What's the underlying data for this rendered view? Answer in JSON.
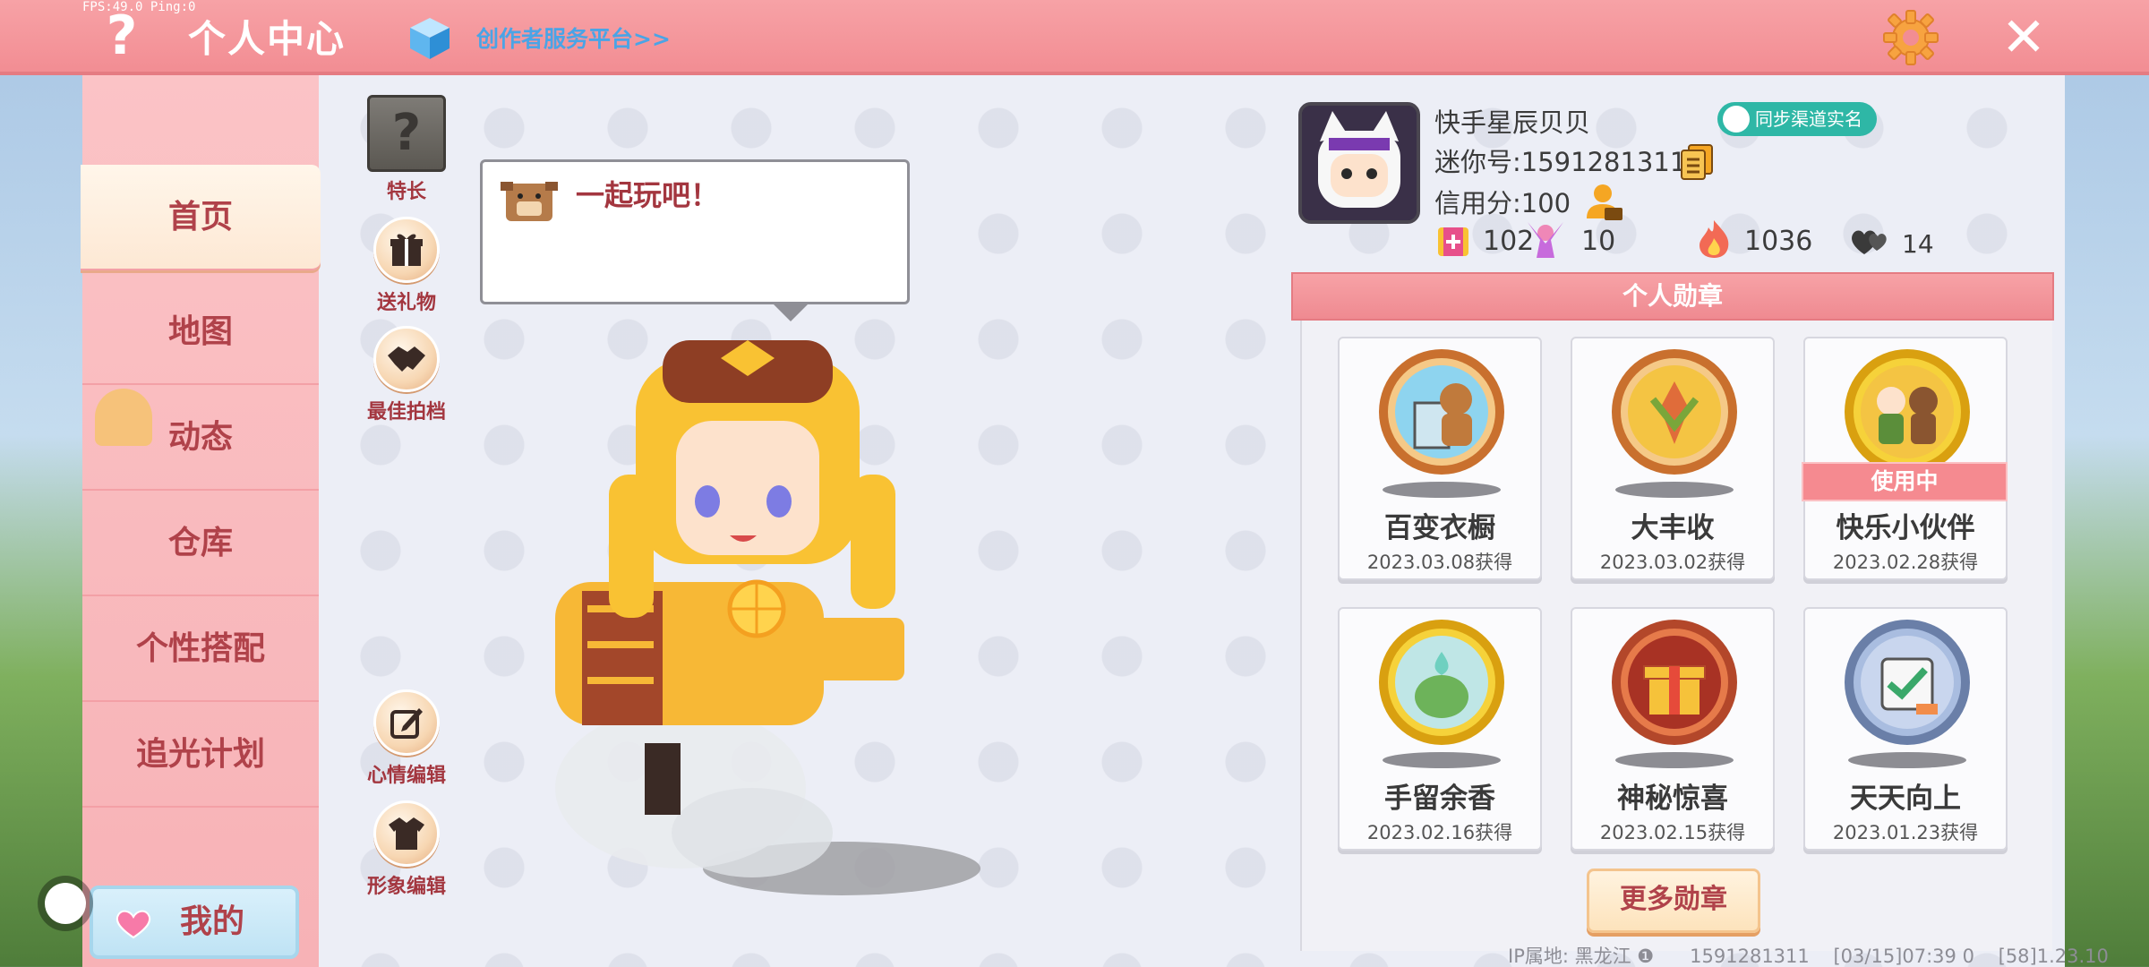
{
  "debug": "FPS:49.0  Ping:0",
  "topbar": {
    "title": "个人中心",
    "creator_link": "创作者服务平台>>",
    "help_glyph": "?",
    "close_glyph": "✕"
  },
  "sidebar": {
    "items": [
      {
        "label": "首页"
      },
      {
        "label": "地图"
      },
      {
        "label": "动态"
      },
      {
        "label": "仓库"
      },
      {
        "label": "个性搭配"
      },
      {
        "label": "追光计划"
      }
    ],
    "mine": "我的"
  },
  "actions": {
    "specialty": "特长",
    "gift": "送礼物",
    "partner": "最佳拍档",
    "mood": "心情编辑",
    "look": "形象编辑"
  },
  "bubble": {
    "text": "一起玩吧！"
  },
  "profile": {
    "name": "快手星辰贝贝",
    "mini_id": "迷你号:1591281311",
    "credit": "信用分:100",
    "sync_badge": "同步渠道实名",
    "stats": {
      "gifts": "102",
      "likes": "10",
      "popularity": "1036",
      "fans": "14"
    }
  },
  "medals": {
    "header": "个人勋章",
    "in_use_label": "使用中",
    "items": [
      {
        "name": "百变衣橱",
        "date": "2023.03.08获得"
      },
      {
        "name": "大丰收",
        "date": "2023.03.02获得"
      },
      {
        "name": "快乐小伙伴",
        "date": "2023.02.28获得"
      },
      {
        "name": "手留余香",
        "date": "2023.02.16获得"
      },
      {
        "name": "神秘惊喜",
        "date": "2023.02.15获得"
      },
      {
        "name": "天天向上",
        "date": "2023.01.23获得"
      }
    ],
    "more_button": "更多勋章"
  },
  "footer": "IP属地: 黑龙江 ❶      1591281311    [03/15]07:39 0    [58]1.23.10",
  "colors": {
    "accent": "#f28d93",
    "text_red": "#b0424a",
    "teal": "#2eb7a6"
  }
}
